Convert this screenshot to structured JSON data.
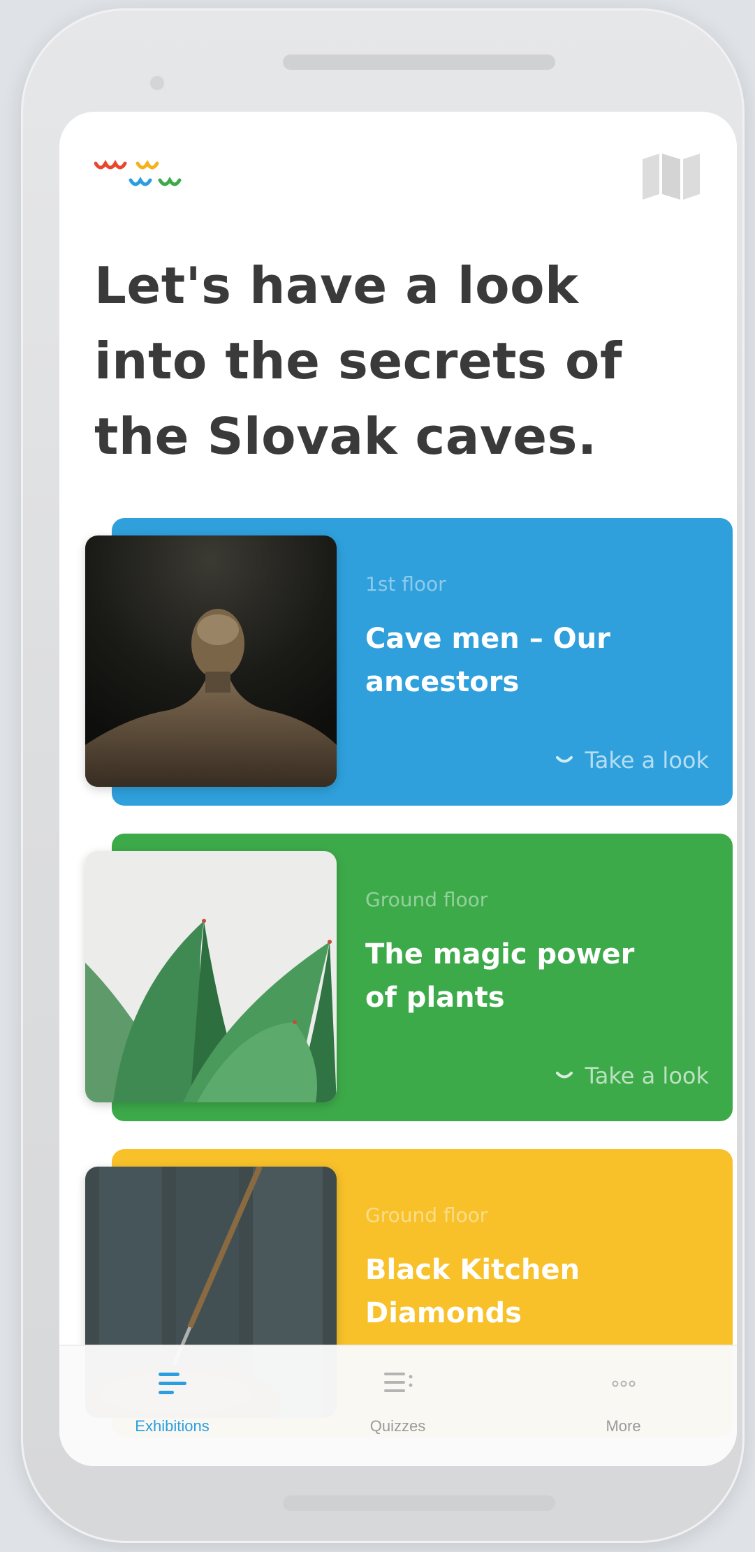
{
  "header": {
    "logo_icon": "wawa-logo-icon",
    "map_icon": "map-icon",
    "headline_lines": [
      "Let's have a look",
      "into the secrets of",
      "the Slovak caves."
    ]
  },
  "exhibitions": [
    {
      "floor": "1st floor",
      "title_lines": [
        "Cave men – Our",
        "ancestors"
      ],
      "action": "Take a look",
      "color": "#2fa0dc",
      "image": "man-in-dark-photo"
    },
    {
      "floor": "Ground floor",
      "title_lines": [
        "The magic power",
        "of plants"
      ],
      "action": "Take a look",
      "color": "#3daa4a",
      "image": "succulent-plant-photo"
    },
    {
      "floor": "Ground floor",
      "title_lines": [
        "Black Kitchen",
        "Diamonds"
      ],
      "action": "",
      "color": "#f8c12a",
      "image": "kitchen-fork-photo"
    }
  ],
  "tabbar": {
    "active_color": "#2a9ee0",
    "inactive_color": "#9a9a9a",
    "tabs": [
      {
        "label": "Exhibitions",
        "icon": "list-icon",
        "active": true
      },
      {
        "label": "Quizzes",
        "icon": "quiz-list-icon",
        "active": false
      },
      {
        "label": "More",
        "icon": "more-dots-icon",
        "active": false
      }
    ]
  }
}
